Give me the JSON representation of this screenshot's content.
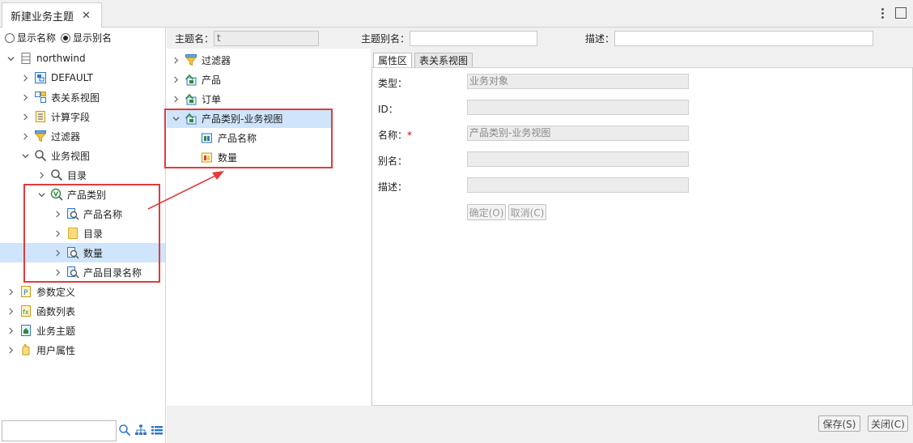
{
  "tab": {
    "title": "新建业务主题",
    "close": "✕"
  },
  "view_options": {
    "show_name": "显示名称",
    "show_alias": "显示别名",
    "selected": "show_alias"
  },
  "left_tree": {
    "root": "northwind",
    "items": [
      {
        "label": "DEFAULT",
        "icon": "datasource-icon"
      },
      {
        "label": "表关系视图",
        "icon": "relation-view-icon"
      },
      {
        "label": "计算字段",
        "icon": "calc-field-icon"
      },
      {
        "label": "过滤器",
        "icon": "filter-icon"
      },
      {
        "label": "业务视图",
        "icon": "business-view-icon"
      },
      {
        "label": "目录",
        "icon": "search-icon"
      },
      {
        "label": "产品类别",
        "icon": "view-v-icon"
      },
      {
        "label": "产品名称",
        "icon": "field-search-icon"
      },
      {
        "label": "目录",
        "icon": "folder-icon"
      },
      {
        "label": "数量",
        "icon": "field-search-icon"
      },
      {
        "label": "产品目录名称",
        "icon": "field-search-icon"
      },
      {
        "label": "参数定义",
        "icon": "param-icon"
      },
      {
        "label": "函数列表",
        "icon": "function-icon"
      },
      {
        "label": "业务主题",
        "icon": "topic-icon"
      },
      {
        "label": "用户属性",
        "icon": "user-attr-icon"
      }
    ]
  },
  "header": {
    "topic_name_label": "主题名：",
    "topic_name_value": "t",
    "alias_label": "主题别名：",
    "alias_value": "",
    "desc_label": "描述：",
    "desc_value": ""
  },
  "mid_tree": {
    "items": [
      {
        "label": "过滤器"
      },
      {
        "label": "产品"
      },
      {
        "label": "订单"
      },
      {
        "label": "产品类别-业务视图"
      },
      {
        "label": "产品名称"
      },
      {
        "label": "数量"
      }
    ]
  },
  "subtabs": {
    "props": "属性区",
    "relation": "表关系视图"
  },
  "props": {
    "type_label": "类型：",
    "type_value": "业务对象",
    "id_label": "ID：",
    "id_value": "",
    "name_label": "名称：",
    "name_required": "*",
    "name_value": "产品类别-业务视图",
    "alias_label": "别名：",
    "alias_value": "",
    "desc_label": "描述：",
    "desc_value": "",
    "ok": "确定(O)",
    "cancel": "取消(C)"
  },
  "footer": {
    "save": "保存(S)",
    "close": "关闭(C)"
  },
  "colors": {
    "selection": "#cfe5fb",
    "highlight_box": "#e03c3c"
  }
}
